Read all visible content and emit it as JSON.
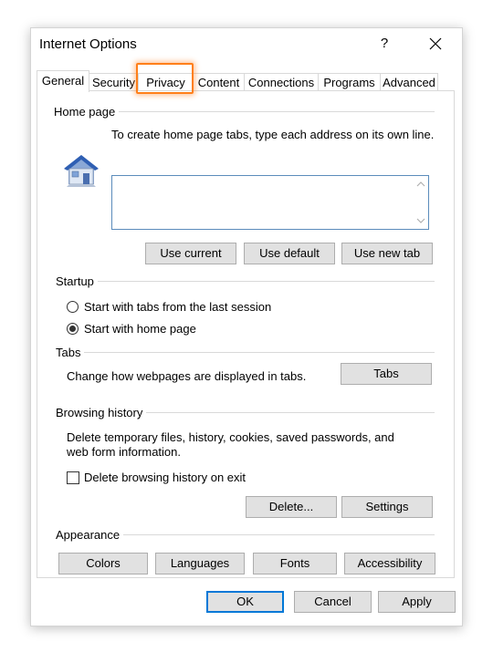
{
  "window": {
    "title": "Internet Options",
    "help_label": "?",
    "close_icon": "close-icon"
  },
  "tabs": [
    "General",
    "Security",
    "Privacy",
    "Content",
    "Connections",
    "Programs",
    "Advanced"
  ],
  "home_page": {
    "group_title": "Home page",
    "description": "To create home page tabs, type each address on its own line.",
    "address_value": "",
    "buttons": {
      "use_current": "Use current",
      "use_default": "Use default",
      "use_new_tab": "Use new tab"
    }
  },
  "startup": {
    "group_title": "Startup",
    "options": [
      "Start with tabs from the last session",
      "Start with home page"
    ],
    "selected_index": 1
  },
  "tabs_group": {
    "group_title": "Tabs",
    "description": "Change how webpages are displayed in tabs.",
    "button": "Tabs"
  },
  "browsing_history": {
    "group_title": "Browsing history",
    "description_line1": "Delete temporary files, history, cookies, saved passwords, and",
    "description_line2": "web form information.",
    "checkbox_label": "Delete browsing history on exit",
    "checkbox_checked": false,
    "delete_button": "Delete...",
    "settings_button": "Settings"
  },
  "appearance": {
    "group_title": "Appearance",
    "buttons": {
      "colors": "Colors",
      "languages": "Languages",
      "fonts": "Fonts",
      "accessibility": "Accessibility"
    }
  },
  "footer": {
    "ok": "OK",
    "cancel": "Cancel",
    "apply": "Apply"
  },
  "colors": {
    "highlight": "#ff7f1a",
    "focus": "#0078d7",
    "button_bg": "#e1e1e1"
  }
}
